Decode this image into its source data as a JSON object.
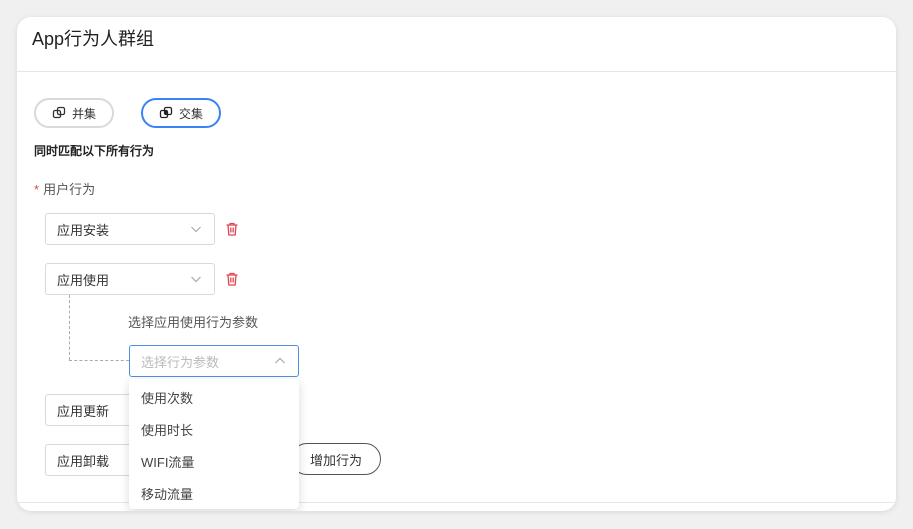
{
  "card": {
    "title": "App行为人群组"
  },
  "mode": {
    "union_label": "并集",
    "intersect_label": "交集",
    "active_color": "#3b82f6"
  },
  "hint": "同时匹配以下所有行为",
  "field": {
    "required_mark": "*",
    "label": "用户行为"
  },
  "behaviors": [
    {
      "label": "应用安装"
    },
    {
      "label": "应用使用"
    },
    {
      "label": "应用更新"
    },
    {
      "label": "应用卸载"
    }
  ],
  "param": {
    "label": "选择应用使用行为参数",
    "placeholder": "选择行为参数",
    "options": [
      "使用次数",
      "使用时长",
      "WIFI流量",
      "移动流量"
    ]
  },
  "add_button": "增加行为",
  "icons": {
    "union": "union-icon",
    "intersect": "intersect-icon",
    "delete": "trash-icon",
    "chevron_down": "chevron-down-icon",
    "chevron_up": "chevron-up-icon"
  },
  "colors": {
    "danger": "#e0454f",
    "focus_border": "#4a90e2"
  }
}
